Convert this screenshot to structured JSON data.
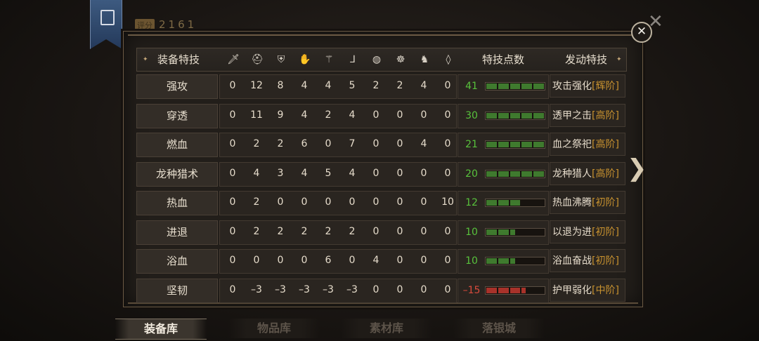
{
  "score": {
    "label": "评分",
    "value": "2161"
  },
  "close_label": "✕",
  "header": {
    "name": "装备特技",
    "points": "特技点数",
    "effect": "发动特技"
  },
  "slot_icons": [
    {
      "name": "sword-icon",
      "glyph": "🗡"
    },
    {
      "name": "helmet-icon",
      "glyph": "⛑"
    },
    {
      "name": "armor-icon",
      "glyph": "⛨"
    },
    {
      "name": "gauntlet-icon",
      "glyph": "✋"
    },
    {
      "name": "belt-icon",
      "glyph": "⚚"
    },
    {
      "name": "boots-icon",
      "glyph": "⅃"
    },
    {
      "name": "talisman-icon",
      "glyph": "◍"
    },
    {
      "name": "decoration-icon",
      "glyph": "☸"
    },
    {
      "name": "pet-icon",
      "glyph": "♞"
    },
    {
      "name": "charm-icon",
      "glyph": "◊"
    }
  ],
  "skills": [
    {
      "name": "强攻",
      "values": [
        "0",
        "12",
        "8",
        "4",
        "4",
        "5",
        "2",
        "2",
        "4",
        "0"
      ],
      "points": "41",
      "fill": 1.0,
      "effect": "攻击强化",
      "tier": "[辉阶]",
      "bar_color": "#3f7a2e"
    },
    {
      "name": "穿透",
      "values": [
        "0",
        "11",
        "9",
        "4",
        "2",
        "4",
        "0",
        "0",
        "0",
        "0"
      ],
      "points": "30",
      "fill": 1.0,
      "effect": "透甲之击",
      "tier": "[高阶]",
      "bar_color": "#3f7a2e"
    },
    {
      "name": "燃血",
      "values": [
        "0",
        "2",
        "2",
        "6",
        "0",
        "7",
        "0",
        "0",
        "4",
        "0"
      ],
      "points": "21",
      "fill": 1.0,
      "effect": "血之祭祀",
      "tier": "[高阶]",
      "bar_color": "#3f7a2e"
    },
    {
      "name": "龙种猎术",
      "values": [
        "0",
        "4",
        "3",
        "4",
        "5",
        "4",
        "0",
        "0",
        "0",
        "0"
      ],
      "points": "20",
      "fill": 1.0,
      "effect": "龙种猎人",
      "tier": "[高阶]",
      "bar_color": "#3f7a2e"
    },
    {
      "name": "热血",
      "values": [
        "0",
        "2",
        "0",
        "0",
        "0",
        "0",
        "0",
        "0",
        "0",
        "10"
      ],
      "points": "12",
      "fill": 0.6,
      "effect": "热血沸腾",
      "tier": "[初阶]",
      "bar_color": "#3f7a2e"
    },
    {
      "name": "进退",
      "values": [
        "0",
        "2",
        "2",
        "2",
        "2",
        "2",
        "0",
        "0",
        "0",
        "0"
      ],
      "points": "10",
      "fill": 0.5,
      "effect": "以退为进",
      "tier": "[初阶]",
      "bar_color": "#3f7a2e"
    },
    {
      "name": "浴血",
      "values": [
        "0",
        "0",
        "0",
        "0",
        "6",
        "0",
        "4",
        "0",
        "0",
        "0"
      ],
      "points": "10",
      "fill": 0.5,
      "effect": "浴血奋战",
      "tier": "[初阶]",
      "bar_color": "#3f7a2e"
    },
    {
      "name": "坚韧",
      "values": [
        "0",
        "–3",
        "–3",
        "–3",
        "–3",
        "–3",
        "0",
        "0",
        "0",
        "0"
      ],
      "points": "–15",
      "fill": 0.68,
      "effect": "护甲弱化",
      "tier": "[中阶]",
      "bar_color": "#a8322a",
      "negative": true
    }
  ],
  "tabs": [
    {
      "label": "装备库",
      "active": true
    },
    {
      "label": "物品库",
      "active": false
    },
    {
      "label": "素材库",
      "active": false
    },
    {
      "label": "落银城",
      "active": false
    }
  ]
}
